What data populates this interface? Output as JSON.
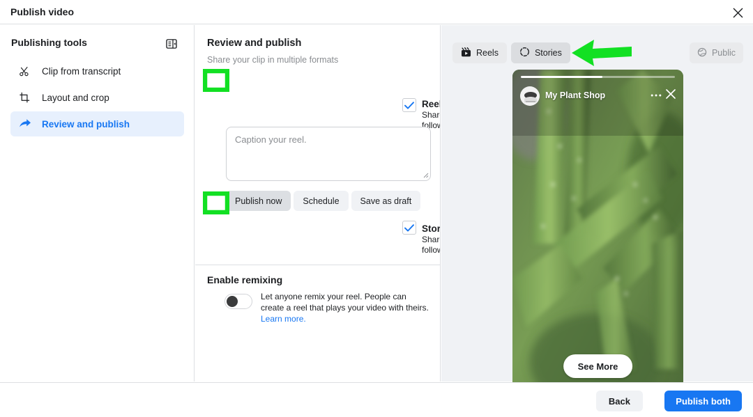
{
  "window": {
    "title": "Publish video",
    "close_icon": "close-icon"
  },
  "sidebar": {
    "heading": "Publishing tools",
    "collapse_icon": "panel-collapse-icon",
    "items": [
      {
        "label": "Clip from transcript",
        "icon": "scissors-icon",
        "active": false
      },
      {
        "label": "Layout and crop",
        "icon": "crop-icon",
        "active": false
      },
      {
        "label": "Review and publish",
        "icon": "share-arrow-icon",
        "active": true
      }
    ]
  },
  "main": {
    "title": "Review and publish",
    "subtitle": "Share your clip in multiple formats",
    "formats": [
      {
        "name": "Reels",
        "description": "Share short, entertaining videos that engage your followers.",
        "checked": true
      },
      {
        "name": "Stories",
        "description": "Share short, temporary highlights that your followers can interact with.",
        "checked": true
      }
    ],
    "caption": {
      "placeholder": "Caption your reel.",
      "value": ""
    },
    "publish_options": [
      {
        "label": "Publish now",
        "selected": true
      },
      {
        "label": "Schedule",
        "selected": false
      },
      {
        "label": "Save as draft",
        "selected": false
      }
    ],
    "remix": {
      "title": "Enable remixing",
      "description_part1": "Let anyone remix your reel. People can create a reel that plays your video with theirs.",
      "learn_more": "Learn more.",
      "toggle_on": false
    }
  },
  "preview": {
    "tabs": [
      {
        "label": "Reels",
        "icon": "clapperboard-icon",
        "active": false
      },
      {
        "label": "Stories",
        "icon": "story-ring-icon",
        "active": true
      }
    ],
    "privacy": {
      "label": "Public",
      "icon": "globe-icon"
    },
    "story": {
      "page_name": "My Plant Shop",
      "menu_icon": "more-options-icon",
      "close_icon": "close-icon",
      "cta_label": "See More",
      "progress_percent": 53
    }
  },
  "footer": {
    "back_label": "Back",
    "primary_label": "Publish both"
  },
  "annotations": {
    "highlight_color": "#12e023",
    "arrow_direction": "left"
  }
}
